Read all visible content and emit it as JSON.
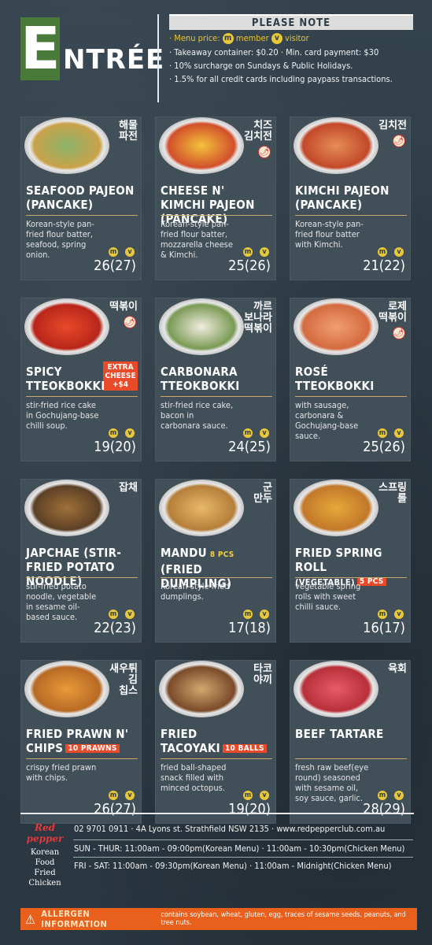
{
  "header": {
    "logo_big": "E",
    "logo_rest": "NTRÉE",
    "note_title": "PLEASE NOTE",
    "menu_price_label": "· Menu price:",
    "member_badge": "m",
    "member_label": "member",
    "visitor_badge": "v",
    "visitor_label": "visitor",
    "line2": "· Takeaway container: $0.20  ·  Min. card payment: $30",
    "line3": "· 10% surcharge on Sundays & Public Holidays.",
    "line4": "· 1.5% for all credit cards including paypass transactions."
  },
  "badges": {
    "m": "m",
    "v": "v"
  },
  "items": [
    {
      "kr": "해물\n파전",
      "name": "SEAFOOD PAJEON (PANCAKE)",
      "desc": "Korean-style pan-fried flour batter, seafood, spring onion.",
      "price": "26(27)",
      "spicy": false,
      "c1": "#8bb36b",
      "c2": "#c9a24a"
    },
    {
      "kr": "치즈\n김치전",
      "name": "CHEESE N' KIMCHI PAJEON (PANCAKE)",
      "desc": "Korean-style pan-fried flour batter, mozzarella cheese & Kimchi.",
      "price": "25(26)",
      "spicy": true,
      "c1": "#f3c23c",
      "c2": "#d2502b"
    },
    {
      "kr": "김치전",
      "name": "KIMCHI PAJEON (PANCAKE)",
      "desc": "Korean-style pan-fried flour batter with Kimchi.",
      "price": "21(22)",
      "spicy": true,
      "c1": "#e58d55",
      "c2": "#c2492a"
    },
    {
      "kr": "떡볶이",
      "name": "SPICY TTEOKBOKKI",
      "desc": "stir-fried rice cake in Gochujang-base chilli soup.",
      "price": "19(20)",
      "spicy": true,
      "c1": "#e84a2a",
      "c2": "#b8261a",
      "extra": "EXTRA CHEESE +$4"
    },
    {
      "kr": "까르\n보나라\n떡볶이",
      "name": "CARBONARA TTEOKBOKKI",
      "desc": "stir-fried rice cake, bacon in carbonara sauce.",
      "price": "24(25)",
      "spicy": false,
      "c1": "#f2eee0",
      "c2": "#7a9a55"
    },
    {
      "kr": "로제\n떡볶이",
      "name": "ROSÉ TTEOKBOKKI",
      "desc": "with sausage, carbonara & Gochujang-base sauce.",
      "price": "25(26)",
      "spicy": true,
      "c1": "#f0a070",
      "c2": "#d46a40"
    },
    {
      "kr": "잡채",
      "name": "JAPCHAE (STIR-FRIED POTATO NOODLE)",
      "desc": "stir-fried potato noodle, vegetable in sesame oil-based sauce.",
      "price": "22(23)",
      "spicy": false,
      "c1": "#a0703a",
      "c2": "#5c4025"
    },
    {
      "kr": "군\n만두",
      "name": "MANDU",
      "tag": "8 PCS",
      "name2": "(FRIED DUMPLING)",
      "desc": "Korean-style fried dumplings.",
      "price": "17(18)",
      "spicy": false,
      "c1": "#e8b86a",
      "c2": "#b57f3a"
    },
    {
      "kr": "스프링\n롤",
      "name": "FRIED SPRING ROLL",
      "name2": "(VEGETABLE)",
      "tag": "5 PCS",
      "desc": "vegetable spring rolls with sweet chilli sauce.",
      "price": "16(17)",
      "spicy": false,
      "c1": "#e8a83a",
      "c2": "#c2782a"
    },
    {
      "kr": "새우튀김\n칩스",
      "name": "FRIED PRAWN N' CHIPS",
      "tag": "10 PRAWNS",
      "desc": "crispy fried prawn with chips.",
      "price": "26(27)",
      "spicy": false,
      "c1": "#e89a3a",
      "c2": "#b86a25"
    },
    {
      "kr": "타코\n야끼",
      "name": "FRIED TACOYAKI",
      "tag": "10 BALLS",
      "desc": "fried ball-shaped snack filled with minced octopus.",
      "price": "19(20)",
      "spicy": false,
      "c1": "#d4a870",
      "c2": "#7a4a2a"
    },
    {
      "kr": "육회",
      "name": "BEEF TARTARE",
      "desc": "fresh raw beef(eye round) seasoned with sesame oil, soy sauce, garlic.",
      "price": "28(29)",
      "spicy": false,
      "c1": "#e85a6a",
      "c2": "#b8303a"
    }
  ],
  "footer": {
    "brand_name": "Red pepper",
    "brand_sub": "Korean Food\nFried Chicken",
    "contact": "02 9701 0911   ·   4A Lyons st. Strathfield NSW 2135   ·   www.redpepperclub.com.au",
    "hours1": "SUN - THUR: 11:00am - 09:00pm(Korean Menu)   ·   11:00am - 10:30pm(Chicken Menu)",
    "hours2": "FRI - SAT: 11:00am - 09:30pm(Korean Menu)   ·   11:00am - Midnight(Chicken Menu)",
    "allergen_title": "ALLERGEN INFORMATION",
    "allergen_text": "contains soybean, wheat, gluten, egg, traces of sesame seeds, peanuts, and tree nuts.",
    "warn_icon": "⚠"
  }
}
